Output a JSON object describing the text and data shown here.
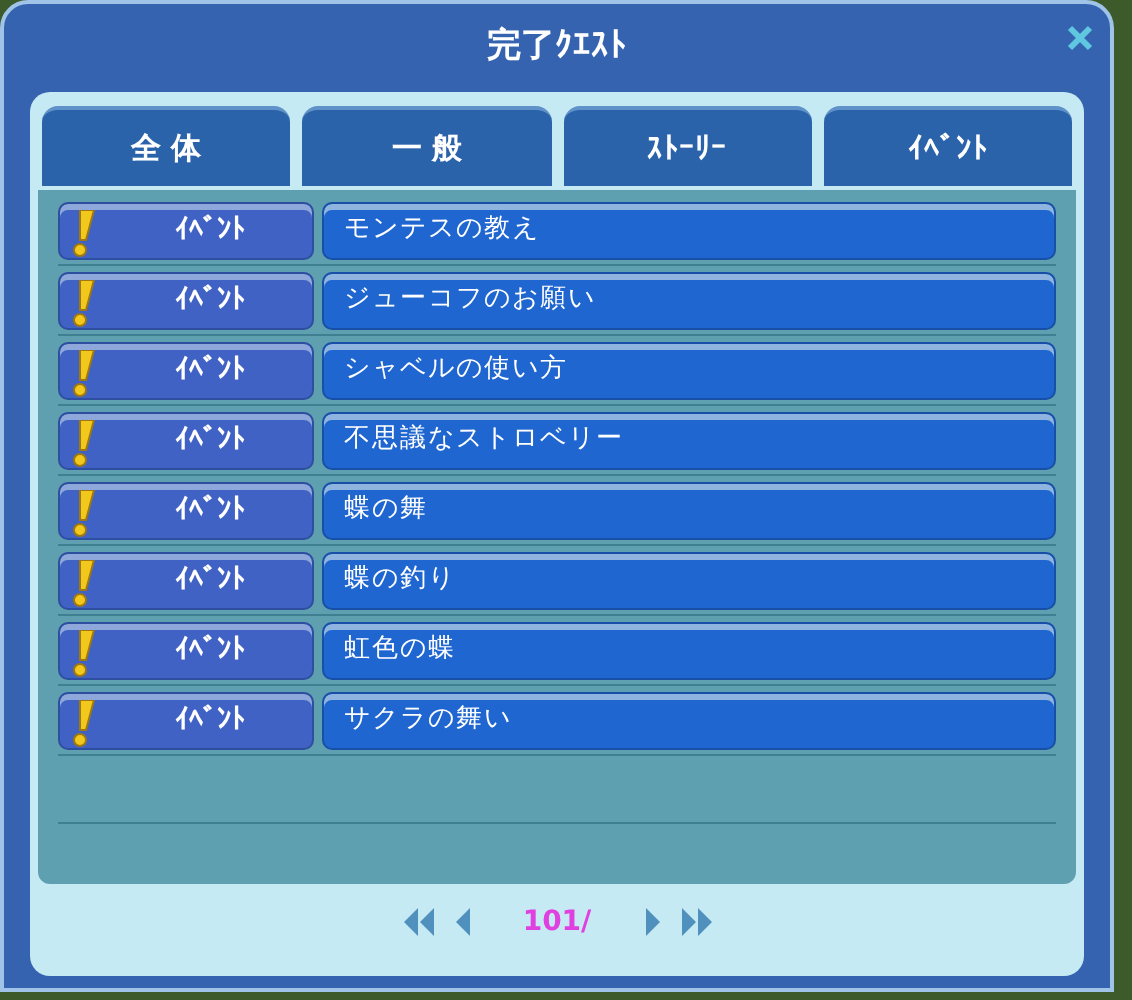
{
  "window": {
    "title": "完了ｸｴｽﾄ"
  },
  "tabs": [
    {
      "label": "全 体",
      "selected": false
    },
    {
      "label": "一 般",
      "selected": false
    },
    {
      "label": "ｽﾄｰﾘｰ",
      "selected": false
    },
    {
      "label": "ｲﾍﾞﾝﾄ",
      "selected": false
    }
  ],
  "quests": [
    {
      "category": "ｲﾍﾞﾝﾄ",
      "title": "モンテスの教え"
    },
    {
      "category": "ｲﾍﾞﾝﾄ",
      "title": "ジューコフのお願い"
    },
    {
      "category": "ｲﾍﾞﾝﾄ",
      "title": "シャベルの使い方"
    },
    {
      "category": "ｲﾍﾞﾝﾄ",
      "title": "不思議なストロベリー"
    },
    {
      "category": "ｲﾍﾞﾝﾄ",
      "title": "蝶の舞"
    },
    {
      "category": "ｲﾍﾞﾝﾄ",
      "title": "蝶の釣り"
    },
    {
      "category": "ｲﾍﾞﾝﾄ",
      "title": "虹色の蝶"
    },
    {
      "category": "ｲﾍﾞﾝﾄ",
      "title": "サクラの舞い"
    }
  ],
  "pager": {
    "page": "101/"
  }
}
